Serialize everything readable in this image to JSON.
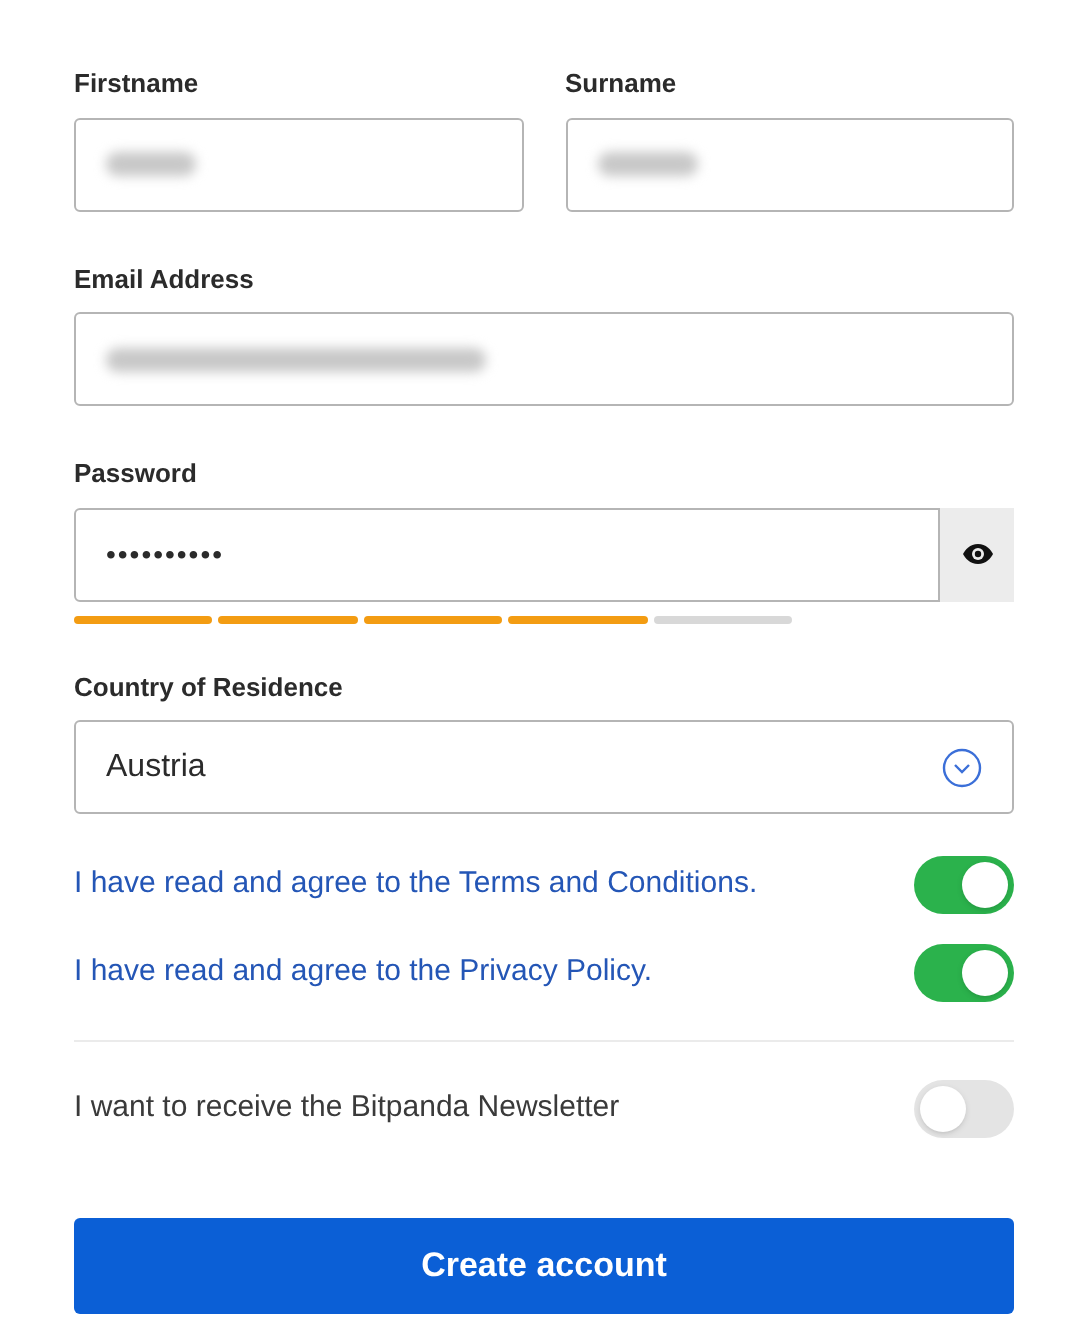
{
  "name_fields": [
    {
      "label": "Firstname",
      "value_blurred": true
    },
    {
      "label": "Surname",
      "value_blurred": true
    }
  ],
  "email": {
    "label": "Email Address",
    "value_blurred": true
  },
  "password": {
    "label": "Password",
    "value": "••••••••••",
    "strength": {
      "level": 0.8
    }
  },
  "country": {
    "label": "Country of Residence",
    "value": "Austria"
  },
  "agreements": [
    {
      "text": "I have read and agree to the Terms and Conditions.",
      "on": true,
      "kind": "link"
    },
    {
      "text": "I have read and agree to the Privacy Policy.",
      "on": true,
      "kind": "link"
    },
    {
      "text": "I want to receive the Bitpanda Newsletter",
      "on": false,
      "kind": "plain"
    }
  ],
  "submit": "Create account"
}
